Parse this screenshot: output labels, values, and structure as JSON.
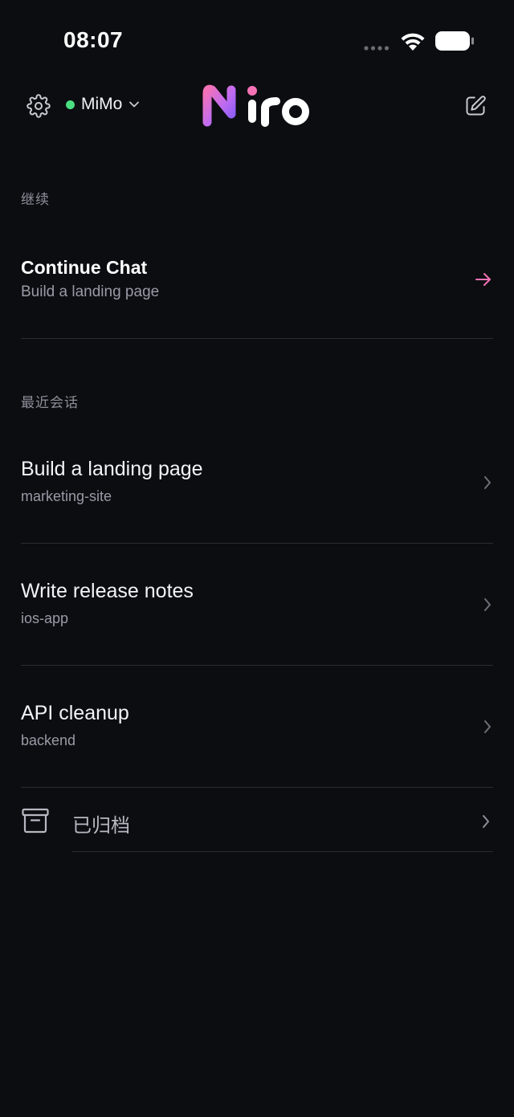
{
  "status_bar": {
    "time": "08:07"
  },
  "header": {
    "model_name": "MiMo",
    "model_status_color": "#4ade80",
    "brand": "Niro",
    "icons": [
      "gear-icon",
      "chevron-down-icon",
      "compose-icon"
    ]
  },
  "continue_section": {
    "label": "继续",
    "title": "Continue Chat",
    "subtitle": "Build a landing page",
    "accent_color": "#f472b6"
  },
  "recent_section": {
    "label": "最近会话",
    "sessions": [
      {
        "title": "Build a landing page",
        "project": "marketing-site"
      },
      {
        "title": "Write release notes",
        "project": "ios-app"
      },
      {
        "title": "API cleanup",
        "project": "backend"
      }
    ]
  },
  "archived": {
    "label": "已归档"
  }
}
